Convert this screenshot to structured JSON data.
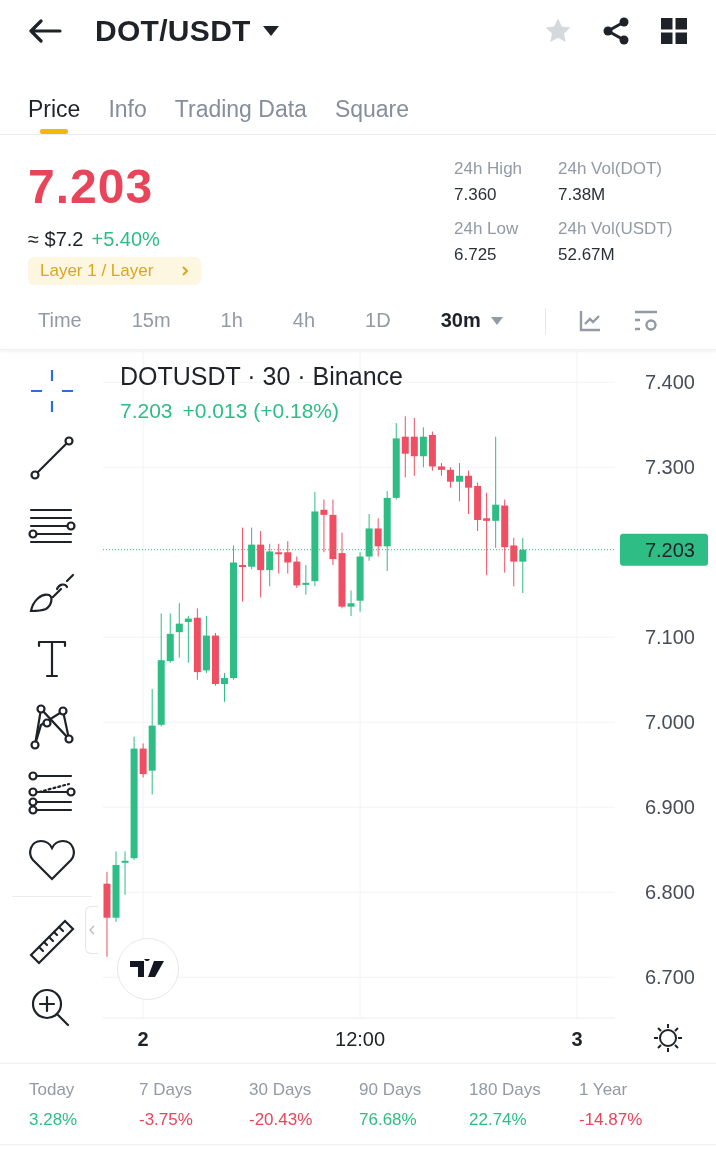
{
  "header": {
    "title": "DOT/USDT"
  },
  "tabs": [
    {
      "label": "Price",
      "selected": true
    },
    {
      "label": "Info",
      "selected": false
    },
    {
      "label": "Trading Data",
      "selected": false
    },
    {
      "label": "Square",
      "selected": false
    }
  ],
  "price": {
    "last": "7.203",
    "color": "#e8455b",
    "fiat": "≈ $7.2",
    "change": {
      "text": "+5.40%",
      "color": "#2ebd85"
    },
    "tag": "Layer 1 / Layer"
  },
  "stats": [
    {
      "label": "24h High",
      "value": "7.360"
    },
    {
      "label": "24h Vol(DOT)",
      "value": "7.38M"
    },
    {
      "label": "24h Low",
      "value": "6.725"
    },
    {
      "label": "24h Vol(USDT)",
      "value": "52.67M"
    }
  ],
  "intervals": [
    {
      "label": "Time",
      "selected": false,
      "dropdown": false
    },
    {
      "label": "15m",
      "selected": false,
      "dropdown": false
    },
    {
      "label": "1h",
      "selected": false,
      "dropdown": false
    },
    {
      "label": "4h",
      "selected": false,
      "dropdown": false
    },
    {
      "label": "1D",
      "selected": false,
      "dropdown": false
    },
    {
      "label": "30m",
      "selected": true,
      "dropdown": true
    }
  ],
  "chart": {
    "symbol": "DOTUSDT · 30 · Binance",
    "last": "7.203",
    "change": "+0.013 (+0.18%)",
    "color": "#2ebd85",
    "chart_data": {
      "type": "candlestick",
      "ylim": [
        6.652,
        7.438
      ],
      "grid": true,
      "ref_lines": [
        {
          "axis": "y",
          "value": 7.203,
          "label": "7.203",
          "color": "#2ebd85"
        }
      ],
      "categories": [
        null,
        null,
        null,
        null,
        "2",
        null,
        null,
        null,
        null,
        null,
        null,
        null,
        null,
        null,
        null,
        null,
        null,
        null,
        null,
        null,
        null,
        null,
        null,
        null,
        null,
        null,
        null,
        null,
        "12:00",
        null,
        null,
        null,
        null,
        null,
        null,
        null,
        null,
        null,
        null,
        null,
        null,
        null,
        null,
        null,
        null,
        null,
        null,
        null,
        null,
        null,
        null,
        null,
        "3",
        null,
        null,
        null,
        null
      ],
      "yticks": [
        {
          "value": 7.4,
          "label": "7.400"
        },
        {
          "value": 7.3,
          "label": "7.300"
        },
        {
          "value": 7.1,
          "label": "7.100"
        },
        {
          "value": 7.0,
          "label": "7.000"
        },
        {
          "value": 6.9,
          "label": "6.900"
        },
        {
          "value": 6.8,
          "label": "6.800"
        },
        {
          "value": 6.7,
          "label": "6.700"
        }
      ],
      "ohlc": [
        [
          6.81,
          6.824,
          6.724,
          6.77
        ],
        [
          6.77,
          6.848,
          6.765,
          6.832
        ],
        [
          6.835,
          6.848,
          6.797,
          6.837
        ],
        [
          6.84,
          6.983,
          6.838,
          6.969
        ],
        [
          6.969,
          6.975,
          6.935,
          6.939
        ],
        [
          6.943,
          7.039,
          6.915,
          6.996
        ],
        [
          6.997,
          7.128,
          6.995,
          7.073
        ],
        [
          7.072,
          7.128,
          7.07,
          7.104
        ],
        [
          7.106,
          7.14,
          7.076,
          7.116
        ],
        [
          7.118,
          7.125,
          7.07,
          7.122
        ],
        [
          7.123,
          7.134,
          7.05,
          7.059
        ],
        [
          7.061,
          7.125,
          7.058,
          7.102
        ],
        [
          7.102,
          7.105,
          7.043,
          7.045
        ],
        [
          7.045,
          7.058,
          7.024,
          7.052
        ],
        [
          7.052,
          7.208,
          7.05,
          7.188
        ],
        [
          7.185,
          7.229,
          7.142,
          7.184
        ],
        [
          7.183,
          7.229,
          7.18,
          7.209
        ],
        [
          7.209,
          7.225,
          7.147,
          7.179
        ],
        [
          7.179,
          7.21,
          7.16,
          7.201
        ],
        [
          7.2,
          7.21,
          7.175,
          7.198
        ],
        [
          7.2,
          7.213,
          7.175,
          7.188
        ],
        [
          7.189,
          7.195,
          7.158,
          7.161
        ],
        [
          7.163,
          7.185,
          7.15,
          7.164
        ],
        [
          7.166,
          7.271,
          7.16,
          7.248
        ],
        [
          7.25,
          7.262,
          7.2,
          7.244
        ],
        [
          7.244,
          7.262,
          7.185,
          7.192
        ],
        [
          7.199,
          7.223,
          7.134,
          7.136
        ],
        [
          7.136,
          7.155,
          7.125,
          7.14
        ],
        [
          7.143,
          7.2,
          7.13,
          7.195
        ],
        [
          7.195,
          7.245,
          7.19,
          7.228
        ],
        [
          7.228,
          7.24,
          7.195,
          7.207
        ],
        [
          7.207,
          7.272,
          7.178,
          7.264
        ],
        [
          7.264,
          7.352,
          7.262,
          7.334
        ],
        [
          7.336,
          7.36,
          7.288,
          7.316
        ],
        [
          7.336,
          7.358,
          7.29,
          7.313
        ],
        [
          7.313,
          7.347,
          7.3,
          7.336
        ],
        [
          7.338,
          7.342,
          7.296,
          7.301
        ],
        [
          7.301,
          7.305,
          7.29,
          7.297
        ],
        [
          7.297,
          7.3,
          7.276,
          7.283
        ],
        [
          7.283,
          7.305,
          7.26,
          7.29
        ],
        [
          7.29,
          7.296,
          7.245,
          7.276
        ],
        [
          7.278,
          7.282,
          7.225,
          7.238
        ],
        [
          7.24,
          7.27,
          7.173,
          7.237
        ],
        [
          7.237,
          7.336,
          7.205,
          7.256
        ],
        [
          7.255,
          7.262,
          7.176,
          7.206
        ],
        [
          7.208,
          7.217,
          7.16,
          7.189
        ],
        [
          7.189,
          7.217,
          7.152,
          7.203
        ],
        null,
        null,
        null,
        null,
        null,
        null,
        null,
        null,
        null,
        null
      ]
    }
  },
  "performance": [
    {
      "label": "Today",
      "value": "3.28%",
      "color": "#2ebd85"
    },
    {
      "label": "7 Days",
      "value": "-3.75%",
      "color": "#e8455b"
    },
    {
      "label": "30 Days",
      "value": "-20.43%",
      "color": "#e8455b"
    },
    {
      "label": "90 Days",
      "value": "76.68%",
      "color": "#2ebd85"
    },
    {
      "label": "180 Days",
      "value": "22.74%",
      "color": "#2ebd85"
    },
    {
      "label": "1 Year",
      "value": "-14.87%",
      "color": "#e8455b"
    }
  ]
}
